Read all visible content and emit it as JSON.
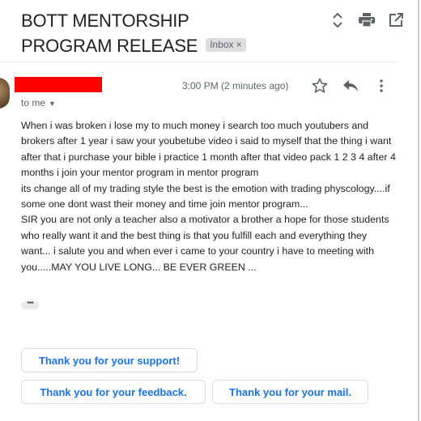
{
  "email": {
    "subject": "BOTT MENTORSHIP PROGRAM RELEASE",
    "label_chip": "Inbox",
    "label_chip_close": "×",
    "recipient": "to me",
    "timestamp": "3:00 PM (2 minutes ago)",
    "body": "When i was broken i lose my to much money i search too much youtubers and brokers after 1 year i saw your youbetube video i said to myself that the thing i want after that i purchase your bible i practice 1 month after that video pack 1 2 3 4 after 4 months i join your mentor program in mentor program\nits change all of my trading style the best is the emotion with trading physcology....if some one dont wast their money and time join mentor program...\nSIR you are not only a teacher also a motivator a brother a hope for those students who really want it and the best thing is that you fulfill each and everything they want... i salute you and when ever i came to your country i have to meeting with you.....MAY YOU LIVE LONG... BE EVER GREEN ...",
    "ellipsis": "•••"
  },
  "smart_replies": [
    {
      "label": "Thank you for your support!"
    },
    {
      "label": "Thank you for your feedback."
    },
    {
      "label": "Thank you for your mail."
    }
  ],
  "colors": {
    "redaction": "#ff0000",
    "link_blue": "#1a73e8",
    "icon_gray": "#5f6368"
  },
  "icons": {
    "top": [
      "expand-collapse-icon",
      "print-icon",
      "open-in-new-window-icon"
    ],
    "message": [
      "star-icon",
      "reply-icon",
      "more-options-icon"
    ]
  }
}
